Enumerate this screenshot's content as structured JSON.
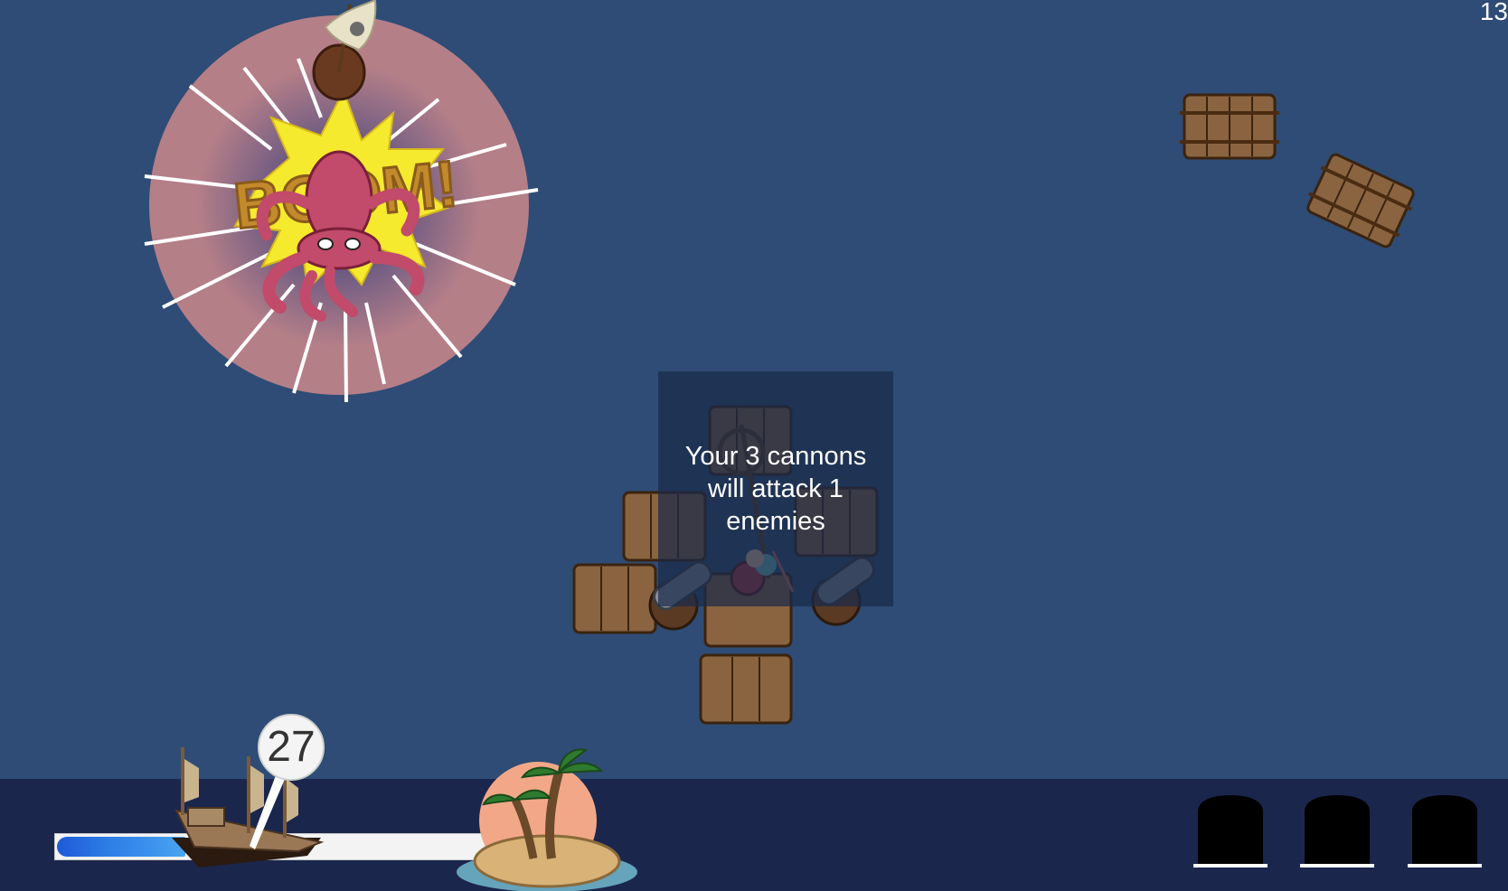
{
  "hud": {
    "score": "13"
  },
  "effects": {
    "boom_text": "BOOM!"
  },
  "tooltip": {
    "line1": "Your 3 cannons",
    "line2": "will attack 1",
    "line3": "enemies"
  },
  "journey": {
    "distance_remaining": "27",
    "progress_fraction": 0.3
  },
  "crew_slots": [
    {
      "name": "crew-slot-1"
    },
    {
      "name": "crew-slot-2"
    },
    {
      "name": "crew-slot-3"
    }
  ],
  "colors": {
    "sea": "#2e4c75",
    "bottom_bar": "#1b264d",
    "progress_fill": "#2d7de6",
    "boom_ring": "#b07a86"
  }
}
